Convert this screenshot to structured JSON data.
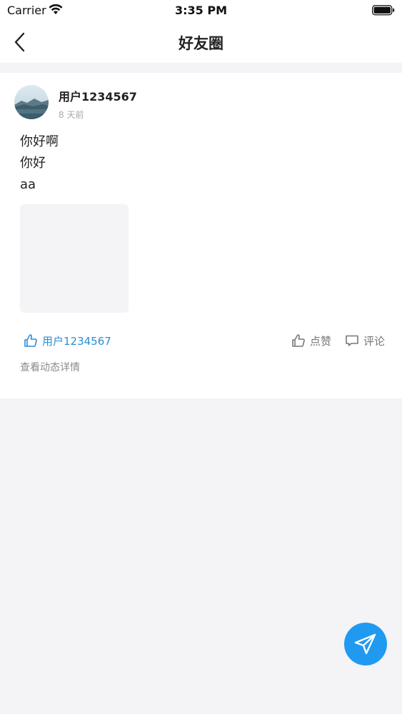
{
  "status_bar": {
    "carrier": "Carrier",
    "time": "3:35 PM"
  },
  "nav": {
    "title": "好友圈",
    "back_icon": "chevron-left-icon"
  },
  "post": {
    "username": "用户1234567",
    "time": "8 天前",
    "content_lines": [
      "你好啊",
      "你好",
      "aa"
    ],
    "likes": {
      "liker_name": "用户1234567"
    },
    "actions": {
      "like_label": "点赞",
      "comment_label": "评论"
    },
    "view_detail_label": "查看动态详情"
  },
  "colors": {
    "accent": "#1f9af0",
    "link_blue": "#2a8fd4",
    "page_background": "#f4f3f6",
    "muted_text": "#8a8a8a"
  }
}
